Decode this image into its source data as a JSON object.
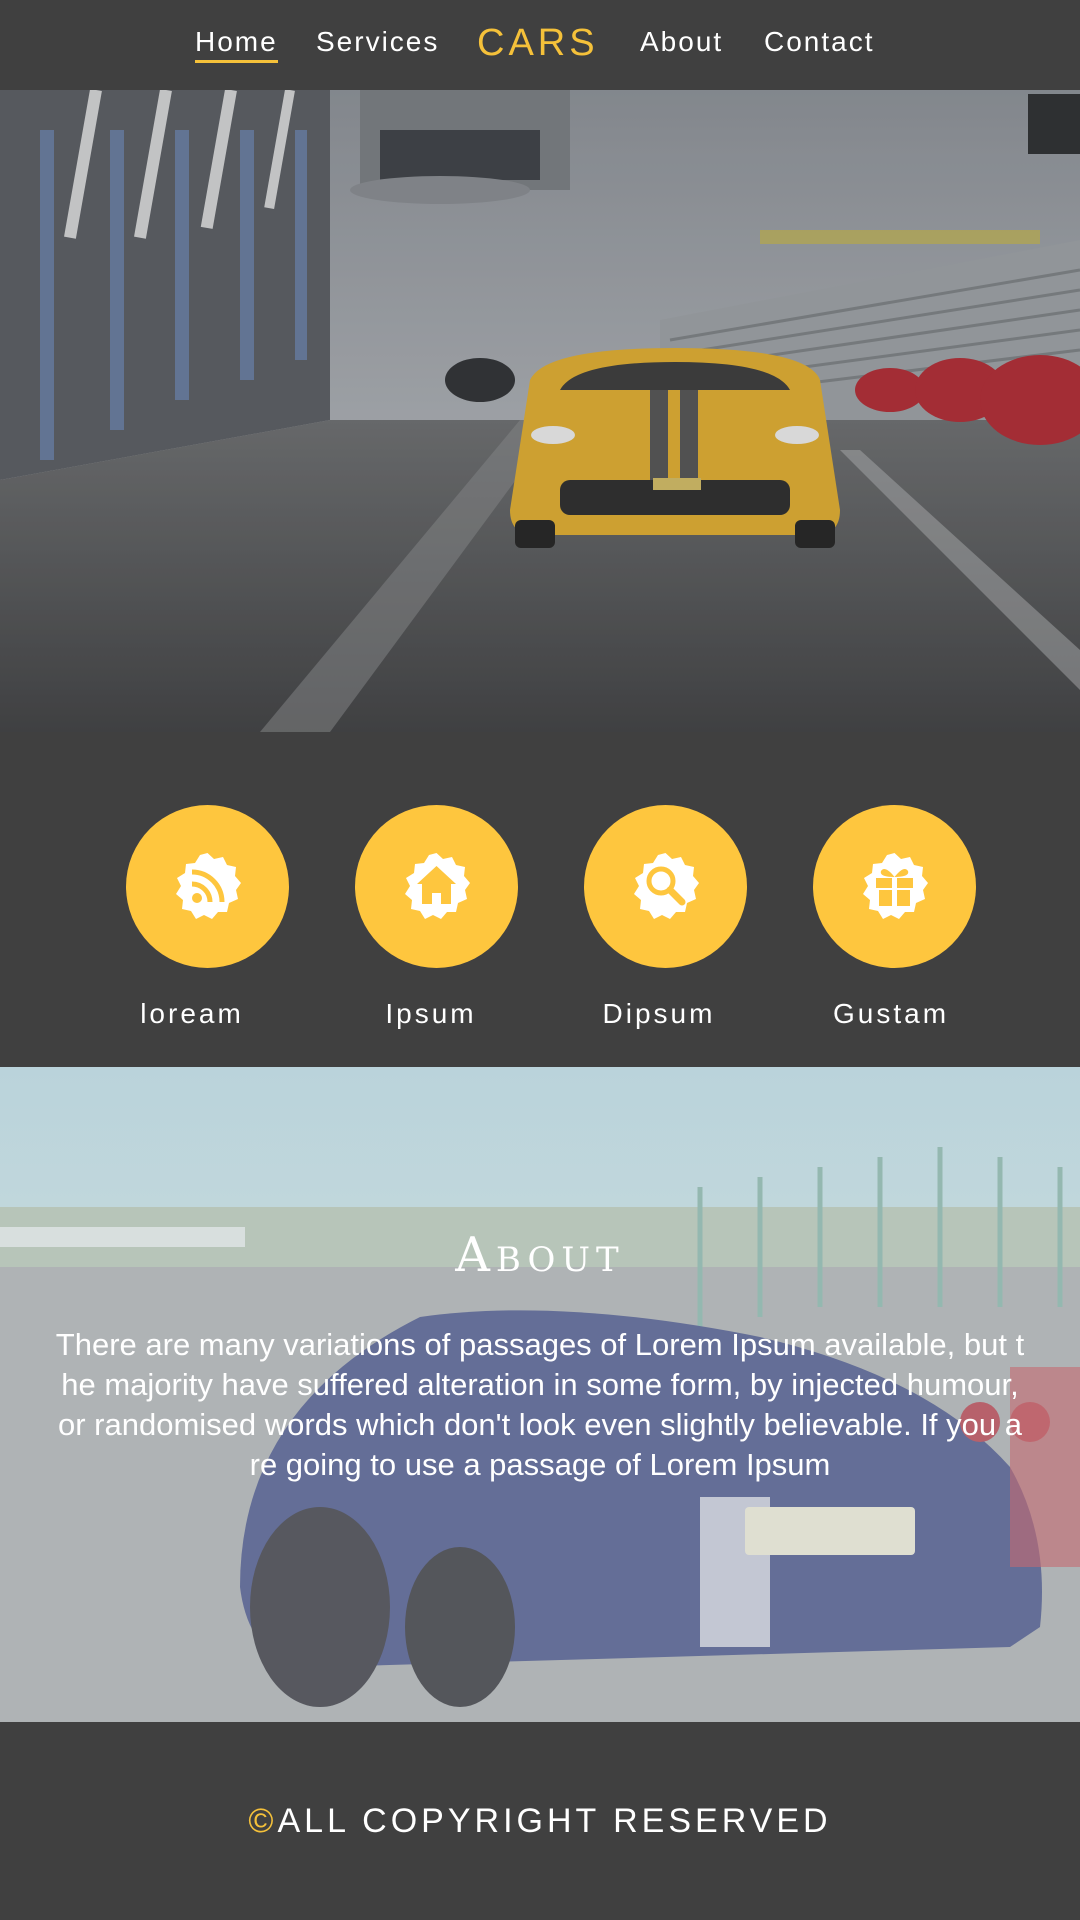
{
  "nav": {
    "items": [
      {
        "label": "Home",
        "active": true
      },
      {
        "label": "Services",
        "active": false
      },
      {
        "label": "About",
        "active": false
      },
      {
        "label": "Contact",
        "active": false
      }
    ],
    "logo": "CARS"
  },
  "features": [
    {
      "label": "loream",
      "icon": "rss-icon"
    },
    {
      "label": "Ipsum",
      "icon": "home-icon"
    },
    {
      "label": "Dipsum",
      "icon": "search-icon"
    },
    {
      "label": "Gustam",
      "icon": "gift-icon"
    }
  ],
  "about": {
    "title": "About",
    "text": "There are many variations of passages of Lorem Ipsum available, but the majority have suffered alteration in some form, by injected humour, or randomised words which don't look even slightly believable. If you are going to use a passage of Lorem Ipsum"
  },
  "footer": {
    "symbol": "©",
    "text": "ALL COPYRIGHT RESERVED"
  },
  "colors": {
    "accent": "#fec63e",
    "background": "#404040"
  }
}
